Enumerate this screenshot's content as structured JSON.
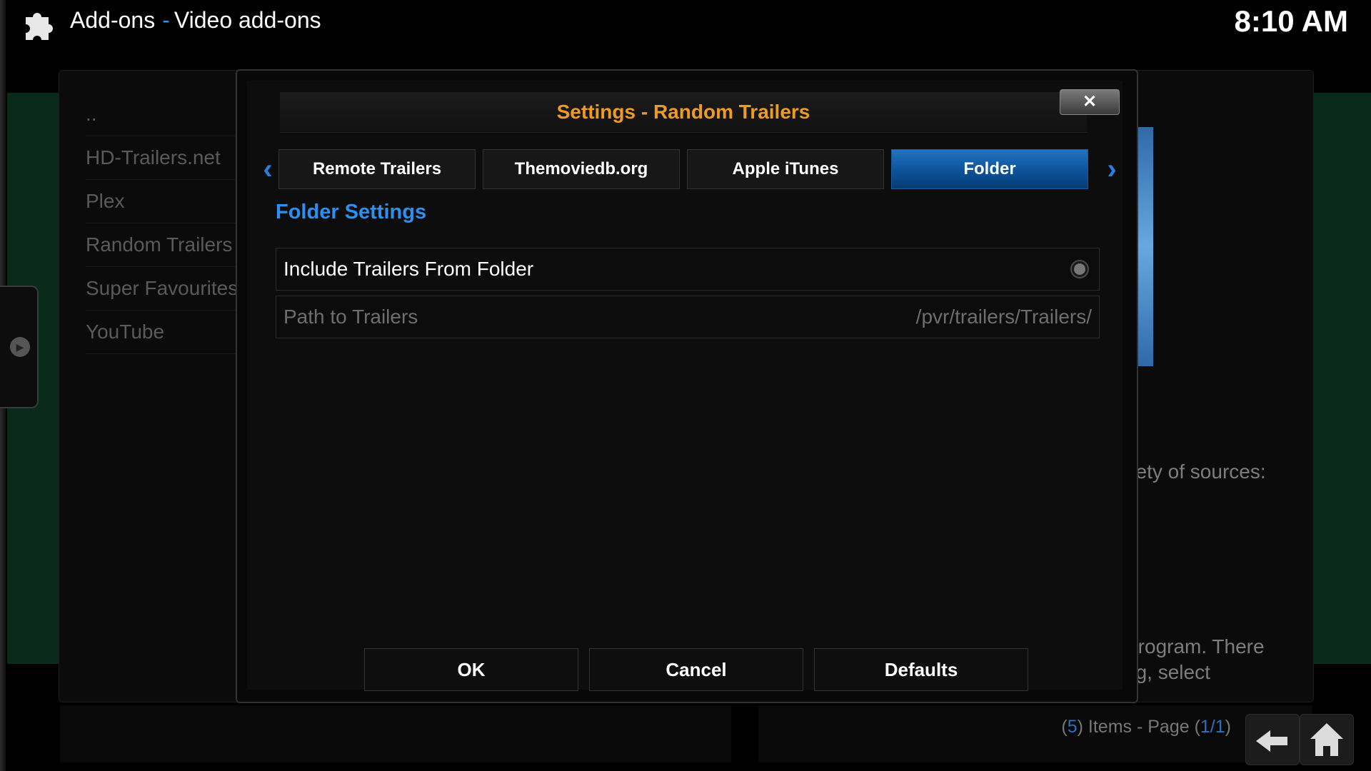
{
  "header": {
    "section": "Add-ons",
    "separator": "-",
    "subsection": "Video add-ons",
    "clock": "8:10 AM",
    "icon": "puzzle-piece-icon"
  },
  "addon_list": {
    "items": [
      {
        "label": ".."
      },
      {
        "label": "HD-Trailers.net"
      },
      {
        "label": "Plex"
      },
      {
        "label": "Random Trailers"
      },
      {
        "label": "Super Favourites"
      },
      {
        "label": "YouTube"
      }
    ]
  },
  "background_description": {
    "line1": "riety of sources:",
    "line2": "Program. There",
    "line3": "ng, select"
  },
  "footer": {
    "open_paren": "(",
    "item_count": "5",
    "items_text": ") Items - Page (",
    "page": "1/1",
    "close_paren": ")",
    "back_icon": "back-arrow-icon",
    "home_icon": "home-icon"
  },
  "dialog": {
    "title": "Settings - Random Trailers",
    "close_label": "✕",
    "tabs": [
      {
        "label": "Remote Trailers",
        "active": false
      },
      {
        "label": "Themoviedb.org",
        "active": false
      },
      {
        "label": "Apple iTunes",
        "active": false
      },
      {
        "label": "Folder",
        "active": true
      }
    ],
    "section_heading": "Folder Settings",
    "settings": [
      {
        "label": "Include Trailers From Folder",
        "type": "toggle",
        "value": false
      },
      {
        "label": "Path to Trailers",
        "value": "/pvr/trailers/Trailers/",
        "enabled": false
      }
    ],
    "buttons": {
      "ok": "OK",
      "cancel": "Cancel",
      "defaults": "Defaults"
    }
  },
  "colors": {
    "accent_blue": "#2d8ff0",
    "title_orange": "#ec9b24",
    "active_tab": "#0c5299"
  }
}
